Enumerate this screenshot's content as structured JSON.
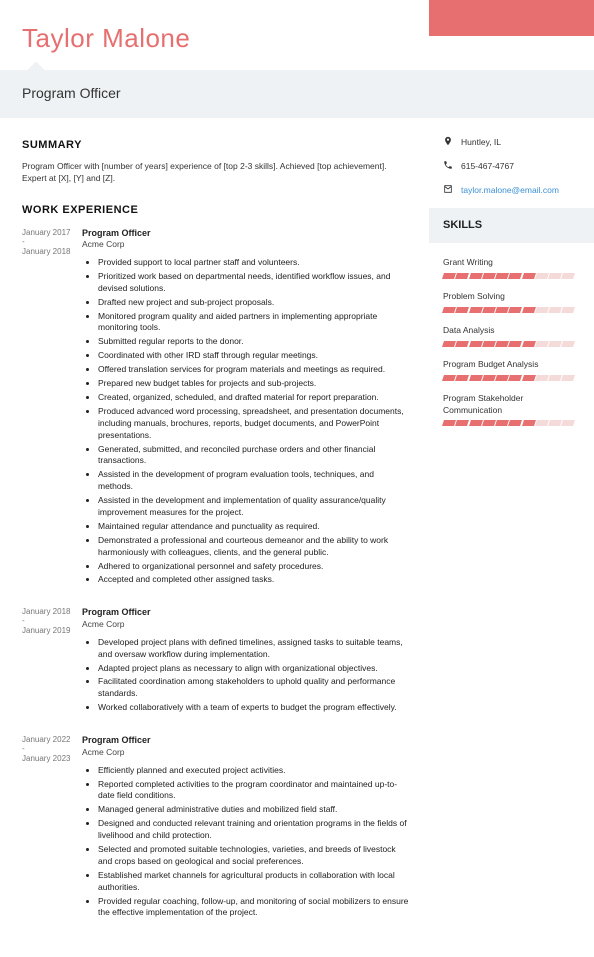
{
  "header": {
    "name": "Taylor Malone",
    "title": "Program Officer"
  },
  "contact": {
    "location": "Huntley, IL",
    "phone": "615-467-4767",
    "email": "taylor.malone@email.com"
  },
  "summary": {
    "title": "SUMMARY",
    "text": "Program Officer with [number of years] experience of [top 2-3 skills]. Achieved [top achievement]. Expert at [X], [Y] and [Z]."
  },
  "work": {
    "title": "WORK EXPERIENCE",
    "jobs": [
      {
        "start": "January 2017",
        "end": "January 2018",
        "role": "Program Officer",
        "company": "Acme Corp",
        "bullets": [
          "Provided support to local partner staff and volunteers.",
          "Prioritized work based on departmental needs, identified workflow issues, and devised solutions.",
          "Drafted new project and sub-project proposals.",
          "Monitored program quality and aided partners in implementing appropriate monitoring tools.",
          "Submitted regular reports to the donor.",
          "Coordinated with other IRD staff through regular meetings.",
          "Offered translation services for program materials and meetings as required.",
          "Prepared new budget tables for projects and sub-projects.",
          "Created, organized, scheduled, and drafted material for report preparation.",
          "Produced advanced word processing, spreadsheet, and presentation documents, including manuals, brochures, reports, budget documents, and PowerPoint presentations.",
          "Generated, submitted, and reconciled purchase orders and other financial transactions.",
          "Assisted in the development of program evaluation tools, techniques, and methods.",
          "Assisted in the development and implementation of quality assurance/quality improvement measures for the project.",
          "Maintained regular attendance and punctuality as required.",
          "Demonstrated a professional and courteous demeanor and the ability to work harmoniously with colleagues, clients, and the general public.",
          "Adhered to organizational personnel and safety procedures.",
          "Accepted and completed other assigned tasks."
        ]
      },
      {
        "start": "January 2018",
        "end": "January 2019",
        "role": "Program Officer",
        "company": "Acme Corp",
        "bullets": [
          "Developed project plans with defined timelines, assigned tasks to suitable teams, and oversaw workflow during implementation.",
          "Adapted project plans as necessary to align with organizational objectives.",
          "Facilitated coordination among stakeholders to uphold quality and performance standards.",
          "Worked collaboratively with a team of experts to budget the program effectively."
        ]
      },
      {
        "start": "January 2022",
        "end": "January 2023",
        "role": "Program Officer",
        "company": "Acme Corp",
        "bullets": [
          "Efficiently planned and executed project activities.",
          "Reported completed activities to the program coordinator and maintained up-to-date field conditions.",
          "Managed general administrative duties and mobilized field staff.",
          "Designed and conducted relevant training and orientation programs in the fields of livelihood and child protection.",
          "Selected and promoted suitable technologies, varieties, and breeds of livestock and crops based on geological and social preferences.",
          "Established market channels for agricultural products in collaboration with local authorities.",
          "Provided regular coaching, follow-up, and monitoring of social mobilizers to ensure the effective implementation of the project."
        ]
      }
    ]
  },
  "skills": {
    "title": "SKILLS",
    "items": [
      {
        "name": "Grant Writing",
        "level": 7
      },
      {
        "name": "Problem Solving",
        "level": 7
      },
      {
        "name": "Data Analysis",
        "level": 7
      },
      {
        "name": "Program Budget Analysis",
        "level": 7
      },
      {
        "name": "Program Stakeholder Communication",
        "level": 7
      }
    ],
    "max": 10
  },
  "colors": {
    "accent": "#e76f6f",
    "band": "#eef2f5",
    "link": "#3a8fd6"
  }
}
